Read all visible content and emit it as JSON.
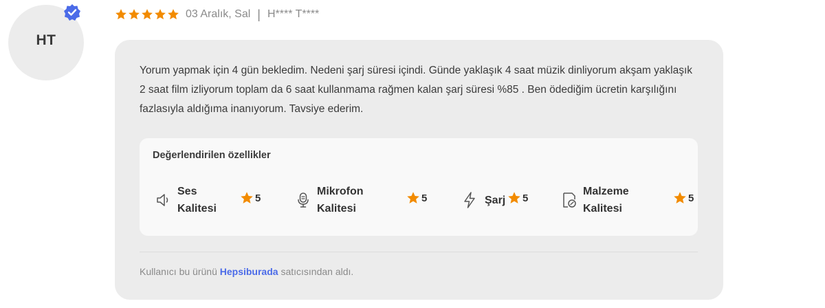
{
  "review": {
    "avatar_initials": "HT",
    "rating": 5,
    "date": "03 Aralık, Sal",
    "separator": "|",
    "user": "H**** T****",
    "text": "Yorum yapmak için 4 gün bekledim. Nedeni şarj süresi içindi. Günde yaklaşık 4 saat müzik dinliyorum akşam yaklaşık 2 saat film izliyorum toplam da 6 saat kullanmama rağmen kalan şarj süresi %85 . Ben ödediğim ücretin karşılığını fazlasıyla aldığıma inanıyorum. Tavsiye ederim."
  },
  "features": {
    "title": "Değerlendirilen özellikler",
    "items": [
      {
        "label_line1": "Ses",
        "label_line2": "Kalitesi",
        "value": "5",
        "icon": "speaker-icon"
      },
      {
        "label_line1": "Mikrofon",
        "label_line2": "Kalitesi",
        "value": "5",
        "icon": "microphone-icon"
      },
      {
        "label_line1": "Şarj",
        "label_line2": "",
        "value": "5",
        "icon": "lightning-icon"
      },
      {
        "label_line1": "Malzeme",
        "label_line2": "Kalitesi",
        "value": "5",
        "icon": "material-icon"
      }
    ]
  },
  "footer": {
    "prefix": "Kullanıcı bu ürünü ",
    "seller": "Hepsiburada",
    "suffix": " satıcısından aldı."
  },
  "colors": {
    "star": "#f28b00",
    "verified": "#4b6be8",
    "brand": "#4b6be8",
    "card_bg": "#ececec"
  }
}
